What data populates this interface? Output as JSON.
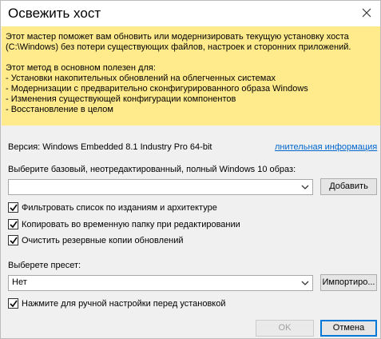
{
  "window": {
    "title": "Освежить хост",
    "close_icon": "close-icon"
  },
  "info": {
    "lines1": [
      "Этот мастер поможет вам обновить или модернизировать текущую установку хоста",
      "(C:\\Windows) без потери существующих файлов, настроек и сторонних приложений."
    ],
    "lines2": [
      "Этот метод в основном полезен для:",
      " - Установки накопительных обновлений на облегченных системах",
      " - Модернизации с предварительно сконфигурированного образа Windows",
      " - Изменения существующей конфигурации компонентов",
      " - Восстановление в целом"
    ]
  },
  "version": {
    "text": "Версия: Windows Embedded 8.1 Industry Pro 64-bit",
    "link": "лнительная информация"
  },
  "image": {
    "label": "Выберите базовый, неотредактированный, полный Windows 10 образ:",
    "value": "",
    "add_button": "Добавить"
  },
  "options": [
    {
      "label": "Фильтровать список по изданиям и архитектуре",
      "checked": true
    },
    {
      "label": "Копировать во временную папку при редактировании",
      "checked": true
    },
    {
      "label": "Очистить резервные копии обновлений",
      "checked": true
    }
  ],
  "preset": {
    "label": "Выберете пресет:",
    "value": "Нет",
    "import_button": "Импортиро..."
  },
  "manual": {
    "label": "Нажмите для ручной настройки перед установкой",
    "checked": true
  },
  "footer": {
    "ok_button": "OK",
    "cancel_button": "Отмена"
  },
  "colors": {
    "info_background": "#ffeb8c",
    "link": "#0066cc",
    "accent": "#0078d7"
  }
}
